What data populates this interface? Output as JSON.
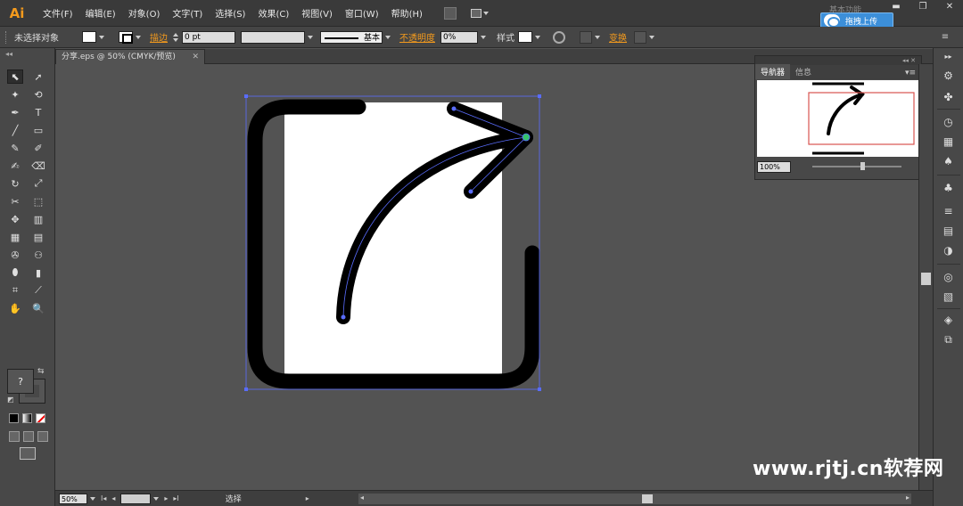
{
  "app": {
    "logo": "Ai",
    "workspace": "基本功能"
  },
  "menus": [
    "文件(F)",
    "编辑(E)",
    "对象(O)",
    "文字(T)",
    "选择(S)",
    "效果(C)",
    "视图(V)",
    "窗口(W)",
    "帮助(H)"
  ],
  "window_controls": {
    "minimize": "▬",
    "restore": "❐",
    "close": "✕"
  },
  "upload": {
    "label": "拖拽上传"
  },
  "control": {
    "selection": "未选择对象",
    "stroke_label": "描边",
    "stroke_weight": "0 pt",
    "brush": "基本",
    "opacity_label": "不透明度",
    "opacity_value": "0%",
    "style_label": "样式",
    "transform_label": "变换"
  },
  "document": {
    "tab_title": "分享.eps @ 50% (CMYK/预览)",
    "close_glyph": "✕"
  },
  "toolbar": {
    "head": "◂◂",
    "tools": [
      "⬉",
      "➚",
      "✦",
      "⟲",
      "✒",
      "T",
      "╱",
      "▭",
      "✎",
      "✐",
      "✍",
      "⌫",
      "↻",
      "⤢",
      "✂",
      "⬚",
      "✥",
      "▥",
      "▦",
      "▤",
      "✇",
      "⚇",
      "⬮",
      "▮",
      "⌗",
      "⟋",
      "✋",
      "🔍"
    ],
    "fill_glyph": "?",
    "swap_glyph": "⇆",
    "default_glyph": "◩"
  },
  "navigator": {
    "tabs": [
      "导航器",
      "信息"
    ],
    "menu": "▾≡",
    "collapse": "◂◂ ✕",
    "zoom": "100%"
  },
  "status": {
    "zoom": "50%",
    "page": "1",
    "tool": "选择",
    "first": "I◂",
    "prev": "◂",
    "next": "▸",
    "last": "▸I",
    "scroll_left": "◂",
    "scroll_right": "▸",
    "menu": "▸"
  },
  "right_dock": {
    "collapse": "▸▸",
    "icons": [
      "⚙",
      "✤",
      "◷",
      "▦",
      "♠",
      "♣",
      "≡",
      "▤",
      "◑",
      "◎",
      "▧",
      "◈",
      "⧉"
    ]
  },
  "watermark": "www.rjtj.cn软荐网"
}
